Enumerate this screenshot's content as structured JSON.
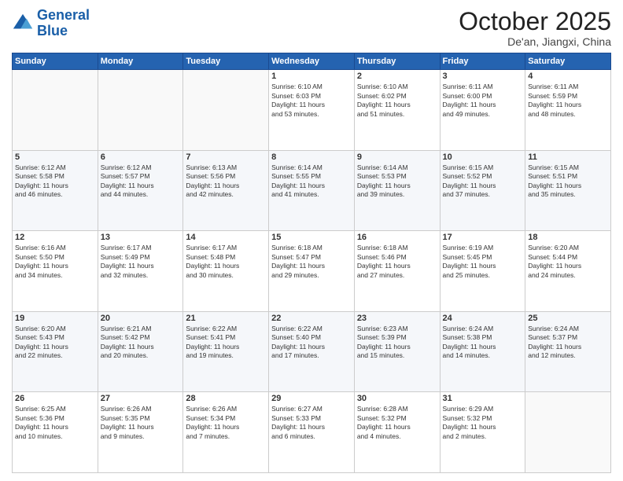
{
  "header": {
    "logo_line1": "General",
    "logo_line2": "Blue",
    "month": "October 2025",
    "location": "De'an, Jiangxi, China"
  },
  "weekdays": [
    "Sunday",
    "Monday",
    "Tuesday",
    "Wednesday",
    "Thursday",
    "Friday",
    "Saturday"
  ],
  "rows": [
    [
      {
        "day": "",
        "text": ""
      },
      {
        "day": "",
        "text": ""
      },
      {
        "day": "",
        "text": ""
      },
      {
        "day": "1",
        "text": "Sunrise: 6:10 AM\nSunset: 6:03 PM\nDaylight: 11 hours\nand 53 minutes."
      },
      {
        "day": "2",
        "text": "Sunrise: 6:10 AM\nSunset: 6:02 PM\nDaylight: 11 hours\nand 51 minutes."
      },
      {
        "day": "3",
        "text": "Sunrise: 6:11 AM\nSunset: 6:00 PM\nDaylight: 11 hours\nand 49 minutes."
      },
      {
        "day": "4",
        "text": "Sunrise: 6:11 AM\nSunset: 5:59 PM\nDaylight: 11 hours\nand 48 minutes."
      }
    ],
    [
      {
        "day": "5",
        "text": "Sunrise: 6:12 AM\nSunset: 5:58 PM\nDaylight: 11 hours\nand 46 minutes."
      },
      {
        "day": "6",
        "text": "Sunrise: 6:12 AM\nSunset: 5:57 PM\nDaylight: 11 hours\nand 44 minutes."
      },
      {
        "day": "7",
        "text": "Sunrise: 6:13 AM\nSunset: 5:56 PM\nDaylight: 11 hours\nand 42 minutes."
      },
      {
        "day": "8",
        "text": "Sunrise: 6:14 AM\nSunset: 5:55 PM\nDaylight: 11 hours\nand 41 minutes."
      },
      {
        "day": "9",
        "text": "Sunrise: 6:14 AM\nSunset: 5:53 PM\nDaylight: 11 hours\nand 39 minutes."
      },
      {
        "day": "10",
        "text": "Sunrise: 6:15 AM\nSunset: 5:52 PM\nDaylight: 11 hours\nand 37 minutes."
      },
      {
        "day": "11",
        "text": "Sunrise: 6:15 AM\nSunset: 5:51 PM\nDaylight: 11 hours\nand 35 minutes."
      }
    ],
    [
      {
        "day": "12",
        "text": "Sunrise: 6:16 AM\nSunset: 5:50 PM\nDaylight: 11 hours\nand 34 minutes."
      },
      {
        "day": "13",
        "text": "Sunrise: 6:17 AM\nSunset: 5:49 PM\nDaylight: 11 hours\nand 32 minutes."
      },
      {
        "day": "14",
        "text": "Sunrise: 6:17 AM\nSunset: 5:48 PM\nDaylight: 11 hours\nand 30 minutes."
      },
      {
        "day": "15",
        "text": "Sunrise: 6:18 AM\nSunset: 5:47 PM\nDaylight: 11 hours\nand 29 minutes."
      },
      {
        "day": "16",
        "text": "Sunrise: 6:18 AM\nSunset: 5:46 PM\nDaylight: 11 hours\nand 27 minutes."
      },
      {
        "day": "17",
        "text": "Sunrise: 6:19 AM\nSunset: 5:45 PM\nDaylight: 11 hours\nand 25 minutes."
      },
      {
        "day": "18",
        "text": "Sunrise: 6:20 AM\nSunset: 5:44 PM\nDaylight: 11 hours\nand 24 minutes."
      }
    ],
    [
      {
        "day": "19",
        "text": "Sunrise: 6:20 AM\nSunset: 5:43 PM\nDaylight: 11 hours\nand 22 minutes."
      },
      {
        "day": "20",
        "text": "Sunrise: 6:21 AM\nSunset: 5:42 PM\nDaylight: 11 hours\nand 20 minutes."
      },
      {
        "day": "21",
        "text": "Sunrise: 6:22 AM\nSunset: 5:41 PM\nDaylight: 11 hours\nand 19 minutes."
      },
      {
        "day": "22",
        "text": "Sunrise: 6:22 AM\nSunset: 5:40 PM\nDaylight: 11 hours\nand 17 minutes."
      },
      {
        "day": "23",
        "text": "Sunrise: 6:23 AM\nSunset: 5:39 PM\nDaylight: 11 hours\nand 15 minutes."
      },
      {
        "day": "24",
        "text": "Sunrise: 6:24 AM\nSunset: 5:38 PM\nDaylight: 11 hours\nand 14 minutes."
      },
      {
        "day": "25",
        "text": "Sunrise: 6:24 AM\nSunset: 5:37 PM\nDaylight: 11 hours\nand 12 minutes."
      }
    ],
    [
      {
        "day": "26",
        "text": "Sunrise: 6:25 AM\nSunset: 5:36 PM\nDaylight: 11 hours\nand 10 minutes."
      },
      {
        "day": "27",
        "text": "Sunrise: 6:26 AM\nSunset: 5:35 PM\nDaylight: 11 hours\nand 9 minutes."
      },
      {
        "day": "28",
        "text": "Sunrise: 6:26 AM\nSunset: 5:34 PM\nDaylight: 11 hours\nand 7 minutes."
      },
      {
        "day": "29",
        "text": "Sunrise: 6:27 AM\nSunset: 5:33 PM\nDaylight: 11 hours\nand 6 minutes."
      },
      {
        "day": "30",
        "text": "Sunrise: 6:28 AM\nSunset: 5:32 PM\nDaylight: 11 hours\nand 4 minutes."
      },
      {
        "day": "31",
        "text": "Sunrise: 6:29 AM\nSunset: 5:32 PM\nDaylight: 11 hours\nand 2 minutes."
      },
      {
        "day": "",
        "text": ""
      }
    ]
  ]
}
